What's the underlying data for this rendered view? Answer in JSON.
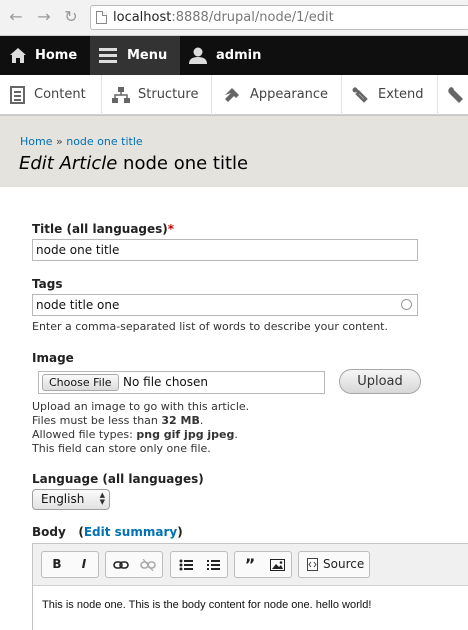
{
  "browser": {
    "url_host": "localhost",
    "url_rest": ":8888/drupal/node/1/edit"
  },
  "toolbar": {
    "home_label": "Home",
    "menu_label": "Menu",
    "admin_label": "admin"
  },
  "tray": {
    "items": [
      {
        "label": "Content",
        "icon": "content-icon"
      },
      {
        "label": "Structure",
        "icon": "structure-icon"
      },
      {
        "label": "Appearance",
        "icon": "appearance-icon"
      },
      {
        "label": "Extend",
        "icon": "extend-icon"
      },
      {
        "label": "",
        "icon": "wrench-icon"
      }
    ]
  },
  "header": {
    "breadcrumb_home": "Home",
    "breadcrumb_sep": "»",
    "breadcrumb_current": "node one title",
    "title_em": "Edit Article",
    "title_rest": " node one title"
  },
  "form": {
    "title_label": "Title (all languages)",
    "title_required": "*",
    "title_value": "node one title",
    "tags_label": "Tags",
    "tags_value": "node title one",
    "tags_desc": "Enter a comma-separated list of words to describe your content.",
    "image_label": "Image",
    "choose_file": "Choose File",
    "no_file": "No file chosen",
    "upload": "Upload",
    "image_desc_1": "Upload an image to go with this article.",
    "image_desc_2_pre": "Files must be less than ",
    "image_desc_2_bold": "32 MB",
    "image_desc_2_post": ".",
    "image_desc_3_pre": "Allowed file types: ",
    "image_desc_3_bold": "png gif jpg jpeg",
    "image_desc_3_post": ".",
    "image_desc_4": "This field can store only one file.",
    "language_label": "Language (all languages)",
    "language_value": "English",
    "body_label": "Body",
    "edit_summary": "Edit summary",
    "paren_open": "(",
    "paren_close": ")"
  },
  "editor": {
    "bold": "B",
    "italic": "I",
    "source": "Source",
    "content": "This is node one.  This is the body content for node one. hello world!"
  }
}
